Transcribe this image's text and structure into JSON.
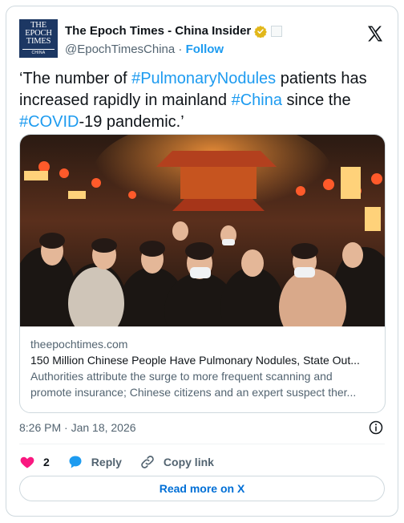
{
  "account": {
    "display_name": "The Epoch Times - China Insider",
    "handle": "@EpochTimesChina",
    "separator": "·",
    "follow_label": "Follow",
    "logo_text": [
      "THE",
      "EPOCH",
      "TIMES"
    ],
    "logo_subtext": "CHINA"
  },
  "tweet": {
    "parts": [
      {
        "text": "‘The number of ",
        "hashtag": false
      },
      {
        "text": "#PulmonaryNodules",
        "hashtag": true
      },
      {
        "text": " patients has increased rapidly in mainland ",
        "hashtag": false
      },
      {
        "text": "#China",
        "hashtag": true
      },
      {
        "text": " since the ",
        "hashtag": false
      },
      {
        "text": "#COVID",
        "hashtag": true
      },
      {
        "text": "-19 pandemic.’",
        "hashtag": false
      }
    ]
  },
  "link_card": {
    "domain": "theepochtimes.com",
    "title": "150 Million Chinese People Have Pulmonary Nodules, State Out...",
    "description_line1": "Authorities attribute the surge to more frequent scanning and",
    "description_line2": "promote insurance; Chinese citizens and an expert suspect ther..."
  },
  "meta": {
    "timestamp": "8:26 PM · Jan 18, 2026"
  },
  "actions": {
    "like_count": "2",
    "reply_label": "Reply",
    "copy_link_label": "Copy link"
  },
  "read_more_label": "Read more on X",
  "colors": {
    "accent": "#1d9bf0",
    "like": "#f91880",
    "verified": "#e2b719",
    "muted": "#536471"
  }
}
